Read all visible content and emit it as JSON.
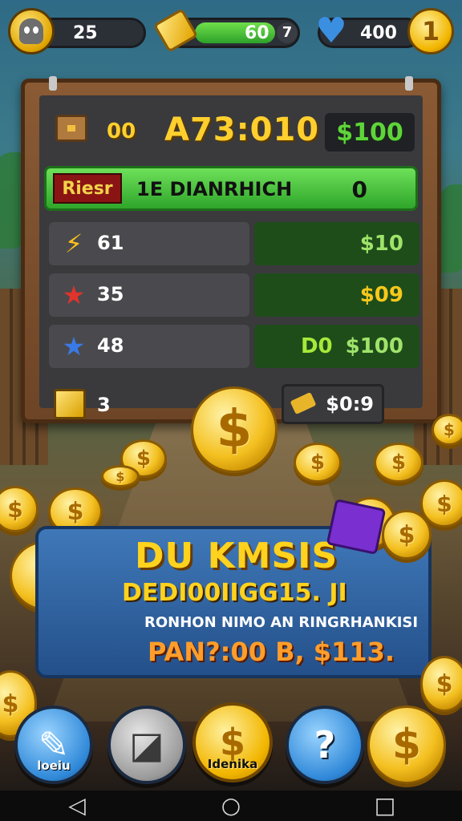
{
  "hud": {
    "lives_value": "25",
    "energy_value": "60",
    "energy_level": "7",
    "gems_value": "400",
    "coin_icon_glyph": "1"
  },
  "board": {
    "chest_count": "00",
    "code": "A73:010",
    "header_money": "$100",
    "highlight_row": {
      "tag": "Riesr",
      "title": "1E DIANRHICH",
      "value": "0"
    },
    "stats": [
      {
        "icon": "lightning-icon",
        "count": "61",
        "reward_prefix": "",
        "reward": "$10"
      },
      {
        "icon": "red-star-icon",
        "count": "35",
        "reward_prefix": "",
        "reward": "$09"
      },
      {
        "icon": "blue-star-icon",
        "count": "48",
        "reward_prefix": "D0",
        "reward": "$100"
      }
    ],
    "bottom_row": {
      "count": "3",
      "price": "$0:9"
    }
  },
  "promo": {
    "title": "DU KMSIS",
    "subtitle": "DEDI00IIGG15. JI",
    "line": "RONHON NIMO AN RINGRHANKISI",
    "price": "PAN?:00 B, $113."
  },
  "buttons": {
    "settings_label": "loeiu",
    "coin_label": "Idenika",
    "help_glyph": "?"
  },
  "colors": {
    "accent_gold": "#f2b600",
    "accent_green": "#2fa62a",
    "promo_blue": "#24508a"
  }
}
